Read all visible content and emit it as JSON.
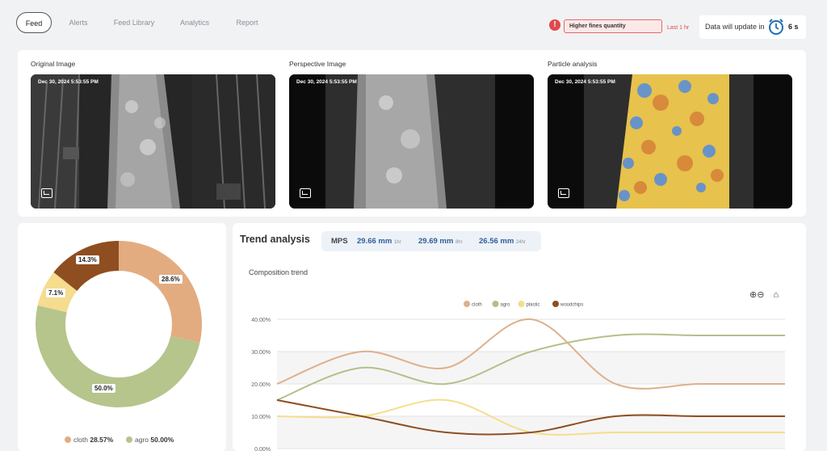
{
  "nav": {
    "tabs": [
      "Feed",
      "Alerts",
      "Feed Library",
      "Analytics",
      "Report"
    ]
  },
  "alert": {
    "icon": "exclamation-icon",
    "text": "Higher fines quantity",
    "time": "Last 1 hr"
  },
  "update": {
    "text": "Data will update in",
    "seconds": "6 s",
    "icon": "alarm-clock-icon"
  },
  "images": [
    {
      "title": "Original Image",
      "timestamp": "Dec 30, 2024 5:53:55 PM"
    },
    {
      "title": "Perspective Image",
      "timestamp": "Dec 30, 2024 5:53:55 PM"
    },
    {
      "title": "Particle analysis",
      "timestamp": "Dec 30, 2024 5:53:55 PM"
    }
  ],
  "donut": {
    "slices": [
      {
        "name": "cloth",
        "value": 28.6,
        "label": "28.6%",
        "color": "#e3ac80"
      },
      {
        "name": "agro",
        "value": 50.0,
        "label": "50.0%",
        "color": "#b5c58c"
      },
      {
        "name": "plastic",
        "value": 7.1,
        "label": "7.1%",
        "color": "#f5dc8f"
      },
      {
        "name": "woodchips",
        "value": 14.3,
        "label": "14.3%",
        "color": "#8f4e1f"
      }
    ],
    "legend": [
      {
        "name": "cloth",
        "value": "28.57%"
      },
      {
        "name": "agro",
        "value": "50.00%"
      }
    ]
  },
  "trend": {
    "title": "Trend analysis",
    "mps_label": "MPS",
    "mps": [
      {
        "value": "29.66 mm",
        "period": "1hr"
      },
      {
        "value": "29.69 mm",
        "period": "8hr"
      },
      {
        "value": "26.56 mm",
        "period": "24hr"
      }
    ],
    "composition_title": "Composition trend",
    "tools": [
      "zoom-in-icon",
      "zoom-out-icon",
      "home-icon"
    ]
  },
  "chart_data": {
    "type": "line",
    "title": "Composition trend",
    "yticks": [
      "0.00%",
      "10.00%",
      "20.00%",
      "30.00%",
      "40.00%"
    ],
    "ylim": [
      0,
      40
    ],
    "grid": true,
    "legend_position": "top",
    "x": [
      0,
      1,
      2,
      3,
      4,
      5,
      6
    ],
    "series": [
      {
        "name": "cloth",
        "color": "#deb08a",
        "values": [
          20,
          30,
          25,
          40,
          20,
          20,
          20
        ]
      },
      {
        "name": "agro",
        "color": "#b3c08a",
        "values": [
          15,
          25,
          20,
          30,
          35,
          35,
          35
        ]
      },
      {
        "name": "plastic",
        "color": "#f5de8c",
        "values": [
          10,
          10,
          15,
          5,
          5,
          5,
          5
        ]
      },
      {
        "name": "woodchips",
        "color": "#8f4e1f",
        "values": [
          15,
          10,
          5,
          5,
          10,
          10,
          10
        ]
      }
    ]
  }
}
